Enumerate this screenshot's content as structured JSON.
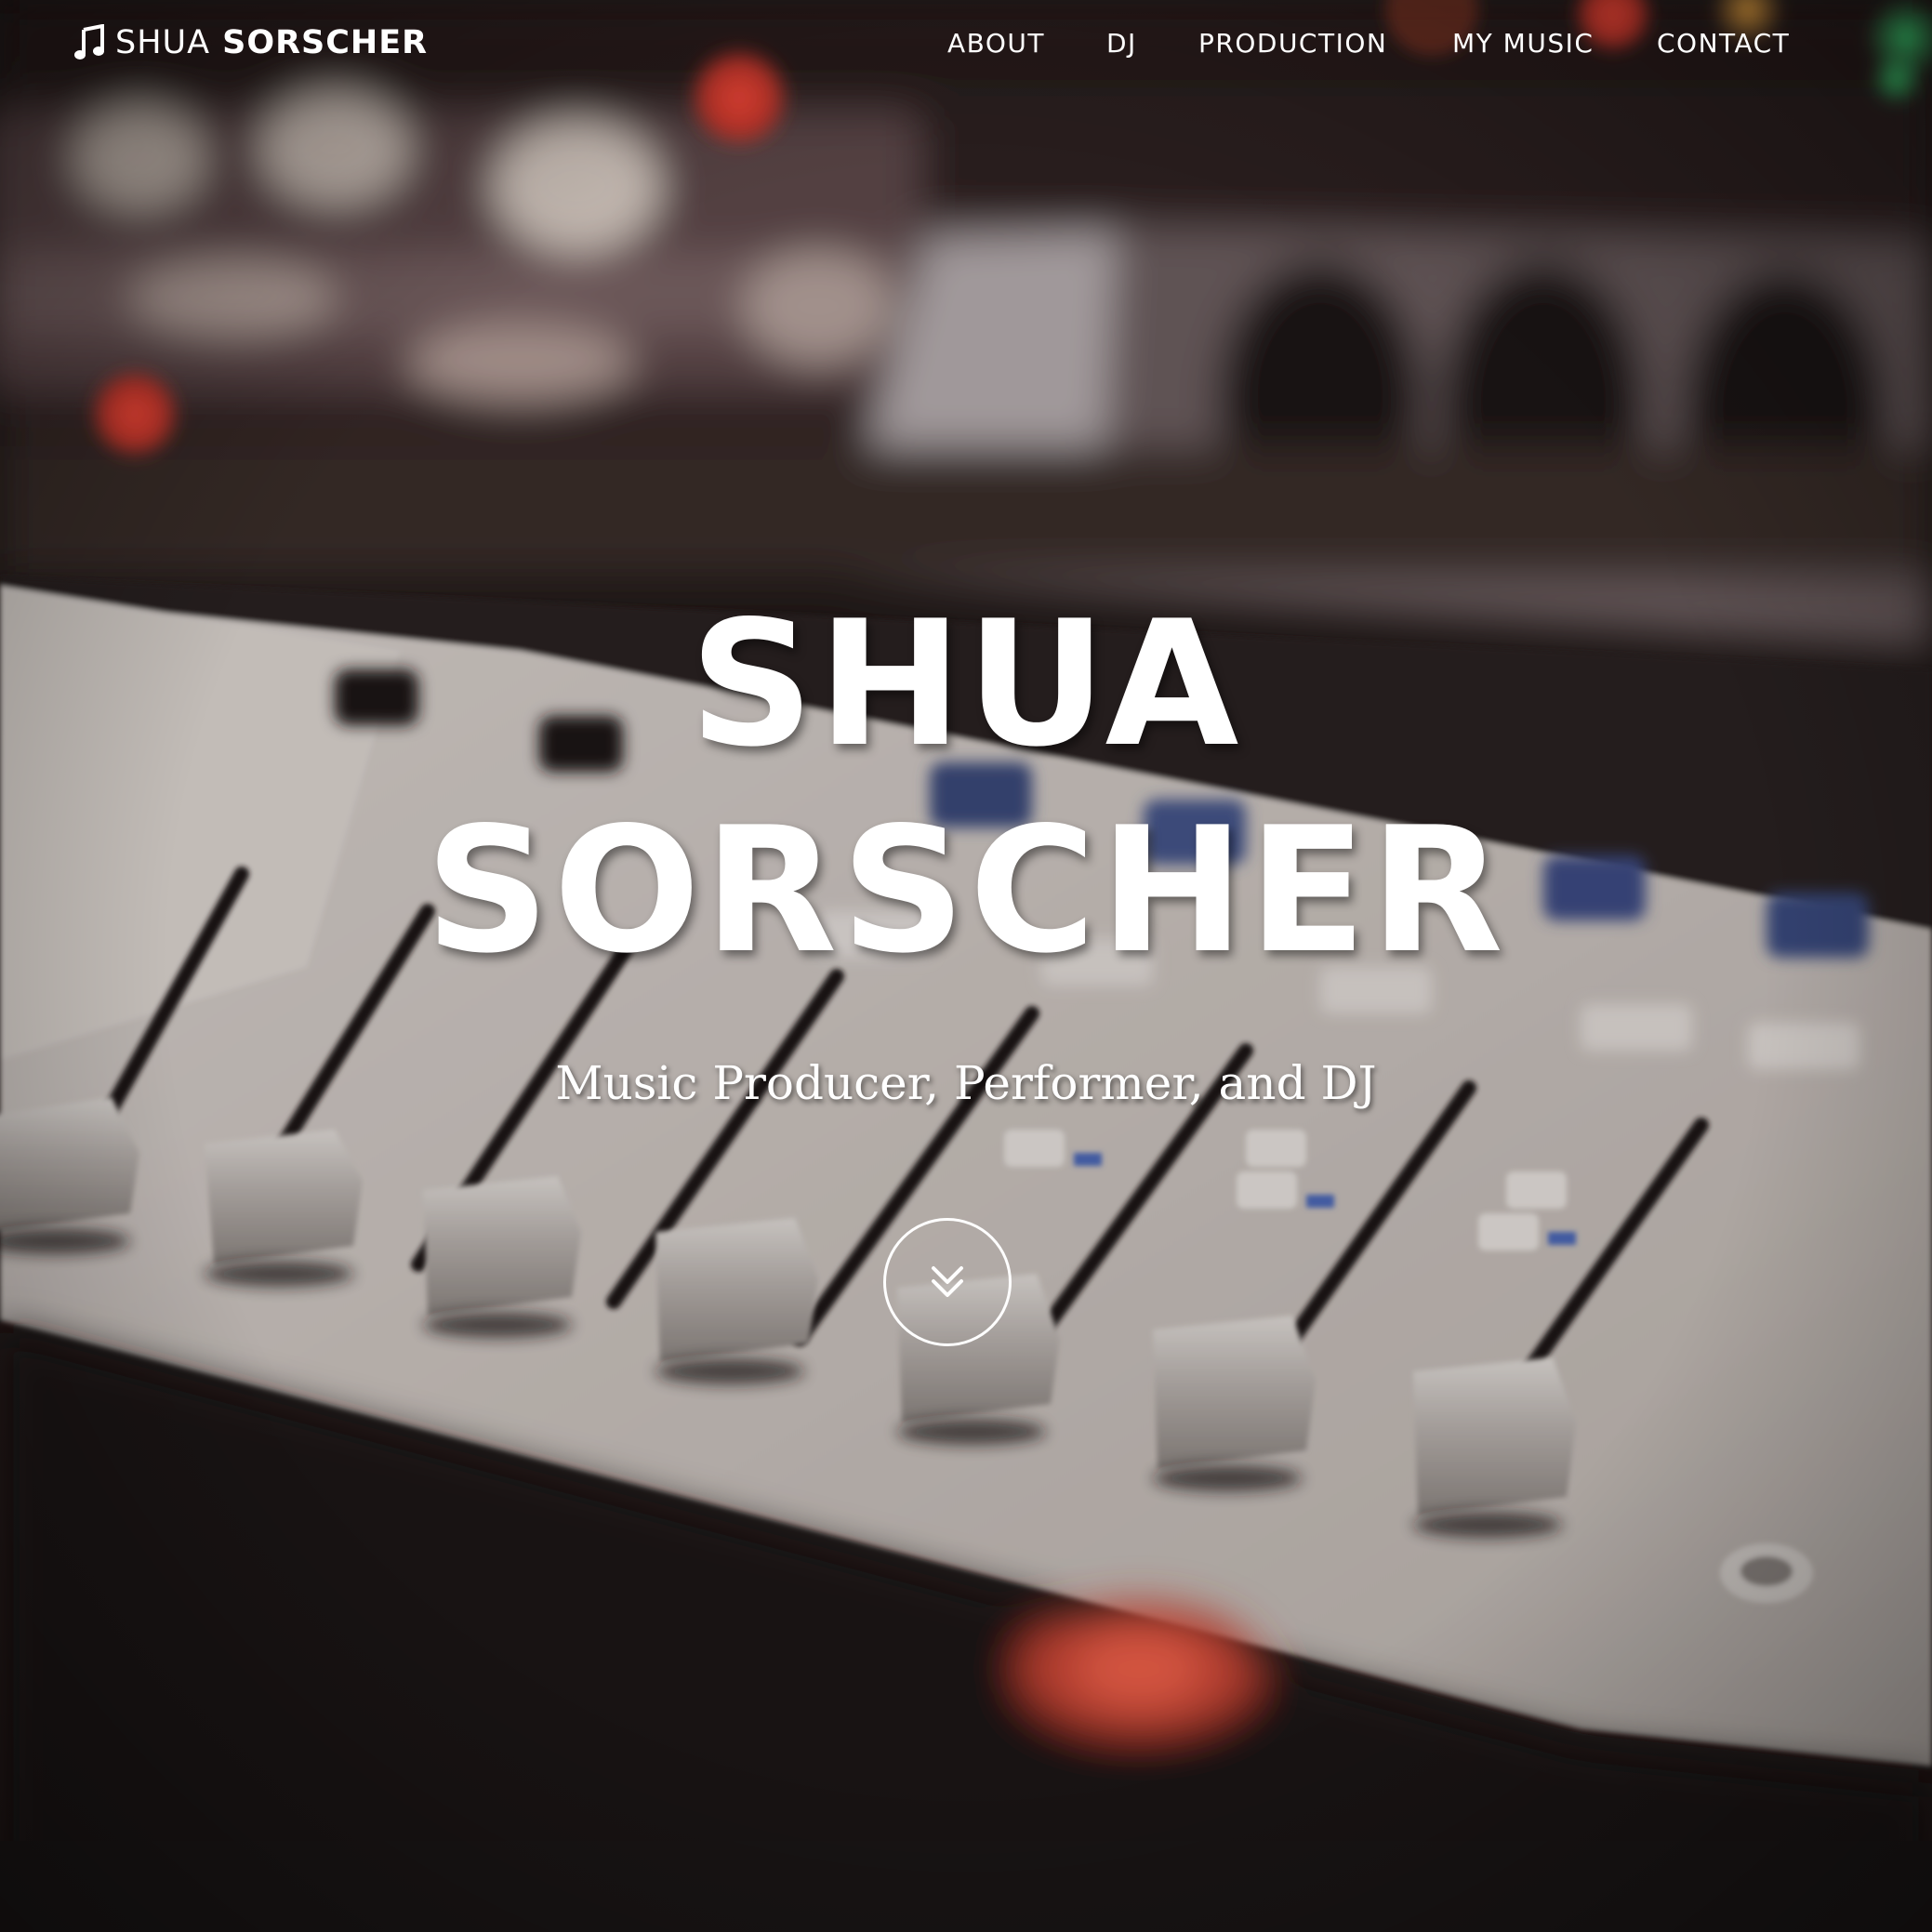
{
  "brand": {
    "icon": "music-note-icon",
    "first_name": "SHUA",
    "last_name": "SORSCHER"
  },
  "nav": {
    "items": [
      {
        "label": "ABOUT"
      },
      {
        "label": "DJ"
      },
      {
        "label": "PRODUCTION"
      },
      {
        "label": "MY MUSIC"
      },
      {
        "label": "CONTACT"
      }
    ]
  },
  "hero": {
    "title_line1": "SHUA",
    "title_line2": "SORSCHER",
    "subtitle": "Music Producer, Performer, and DJ",
    "scroll_icon": "double-chevron-down-icon",
    "background": "blurred-mixing-console-photo"
  },
  "colors": {
    "text": "#ffffff",
    "background_dark": "#1b1615",
    "console_panel": "#cfc8c3"
  }
}
